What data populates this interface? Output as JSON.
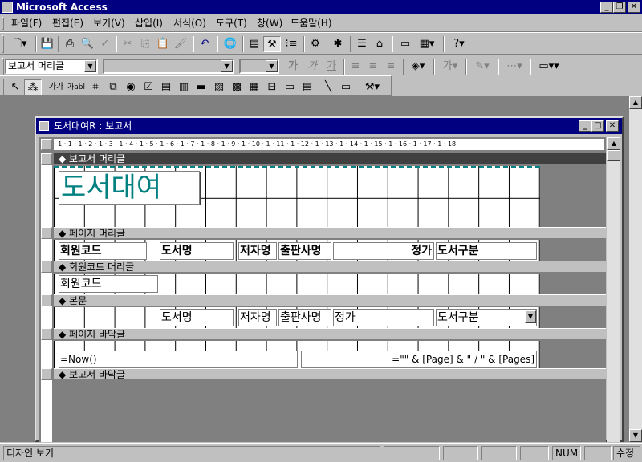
{
  "app": {
    "title": "Microsoft Access"
  },
  "menu": [
    "파일(F)",
    "편집(E)",
    "보기(V)",
    "삽입(I)",
    "서식(O)",
    "도구(T)",
    "창(W)",
    "도움말(H)"
  ],
  "formatting": {
    "object_combo": "보고서 머리글",
    "font_combo": "",
    "size_combo": "",
    "bold_label": "가",
    "italic_label": "가",
    "underline_label": "가"
  },
  "toolbox": {
    "label_tool": "가가",
    "textbox_tool": "가abl"
  },
  "document": {
    "title": "도서대여R : 보고서",
    "ruler_text": "· 1 · 1 · 1 · 2 · 1 · 3 · 1 · 4 · 1 · 5 · 1 · 6 · 1 · 7 · 1 · 8 · 1 · 9 · 1 · 10 · 1 · 11 · 1 · 12 · 1 · 13 · 1 · 14 · 1 · 15 · 1 · 16 · 1 · 17 · 1 · 18"
  },
  "sections": {
    "report_header": "보고서 머리글",
    "page_header": "페이지 머리글",
    "group_header": "회원코드 머리글",
    "detail": "본문",
    "page_footer": "페이지 바닥글",
    "report_footer": "보고서 바닥글"
  },
  "report_header": {
    "title_label": "도서대여"
  },
  "page_header": {
    "labels": [
      "회원코드",
      "도서명",
      "저자명",
      "출판사명",
      "정가",
      "도서구분"
    ]
  },
  "group_header": {
    "member_code": "회원코드"
  },
  "detail": {
    "fields": [
      "도서명",
      "저자명",
      "출판사명",
      "정가",
      "도서구분"
    ]
  },
  "page_footer": {
    "now_expr": "=Now()",
    "page_expr": "=\"\" & [Page] & \" / \" & [Pages]"
  },
  "status": {
    "view": "디자인 보기",
    "num": "NUM",
    "mode": "수정"
  }
}
